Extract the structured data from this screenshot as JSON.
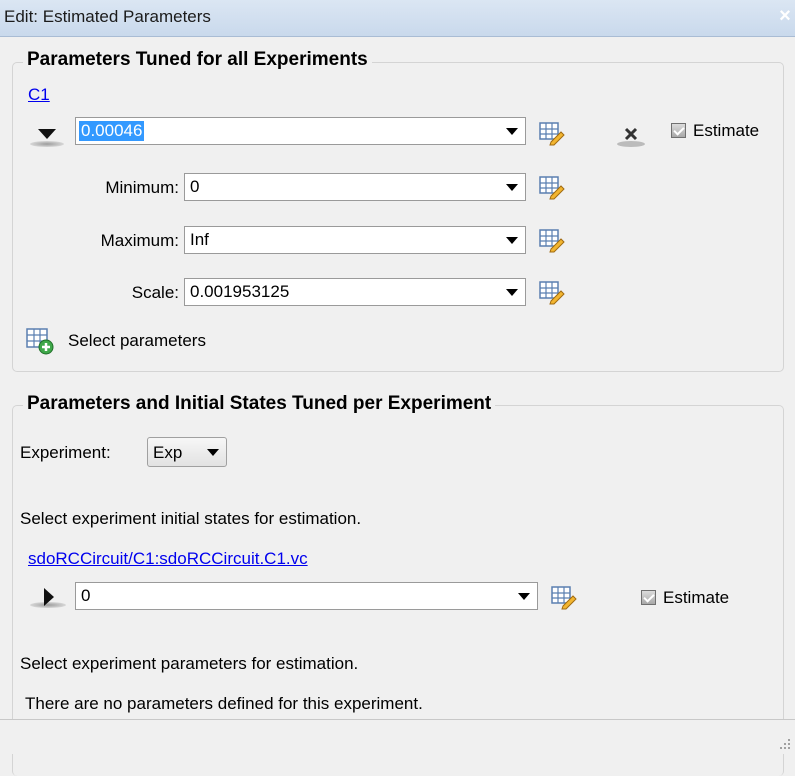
{
  "window": {
    "title": "Edit: Estimated Parameters",
    "close_glyph": "×"
  },
  "global_section": {
    "title": "Parameters Tuned for all Experiments",
    "parameter_link": "C1",
    "value": "0.00046",
    "minimum_label": "Minimum:",
    "minimum_value": "0",
    "maximum_label": "Maximum:",
    "maximum_value": "Inf",
    "scale_label": "Scale:",
    "scale_value": "0.001953125",
    "estimate_label": "Estimate",
    "estimate_checked": true,
    "select_parameters_label": "Select parameters"
  },
  "experiment_section": {
    "title": "Parameters and Initial States Tuned per Experiment",
    "experiment_label": "Experiment:",
    "experiment_value": "Exp",
    "initial_states_prompt": "Select experiment initial states for estimation.",
    "state_link": "sdoRCCircuit/C1:sdoRCCircuit.C1.vc",
    "state_value": "0",
    "estimate_label": "Estimate",
    "estimate_checked": true,
    "parameters_prompt": "Select experiment parameters for estimation.",
    "no_parameters_message": "There are no parameters defined for this experiment."
  },
  "icons": {
    "expand_collapsed": "triangle-down-icon",
    "expand_right": "triangle-right-icon",
    "edit": "table-edit-icon",
    "remove": "remove-x-icon",
    "add": "table-add-icon",
    "resize": "resize-grip-icon"
  },
  "colors": {
    "link": "#0000ee",
    "selection": "#3399ff",
    "titlebar": "#c9d9ec",
    "panel": "#f0f0f0"
  }
}
